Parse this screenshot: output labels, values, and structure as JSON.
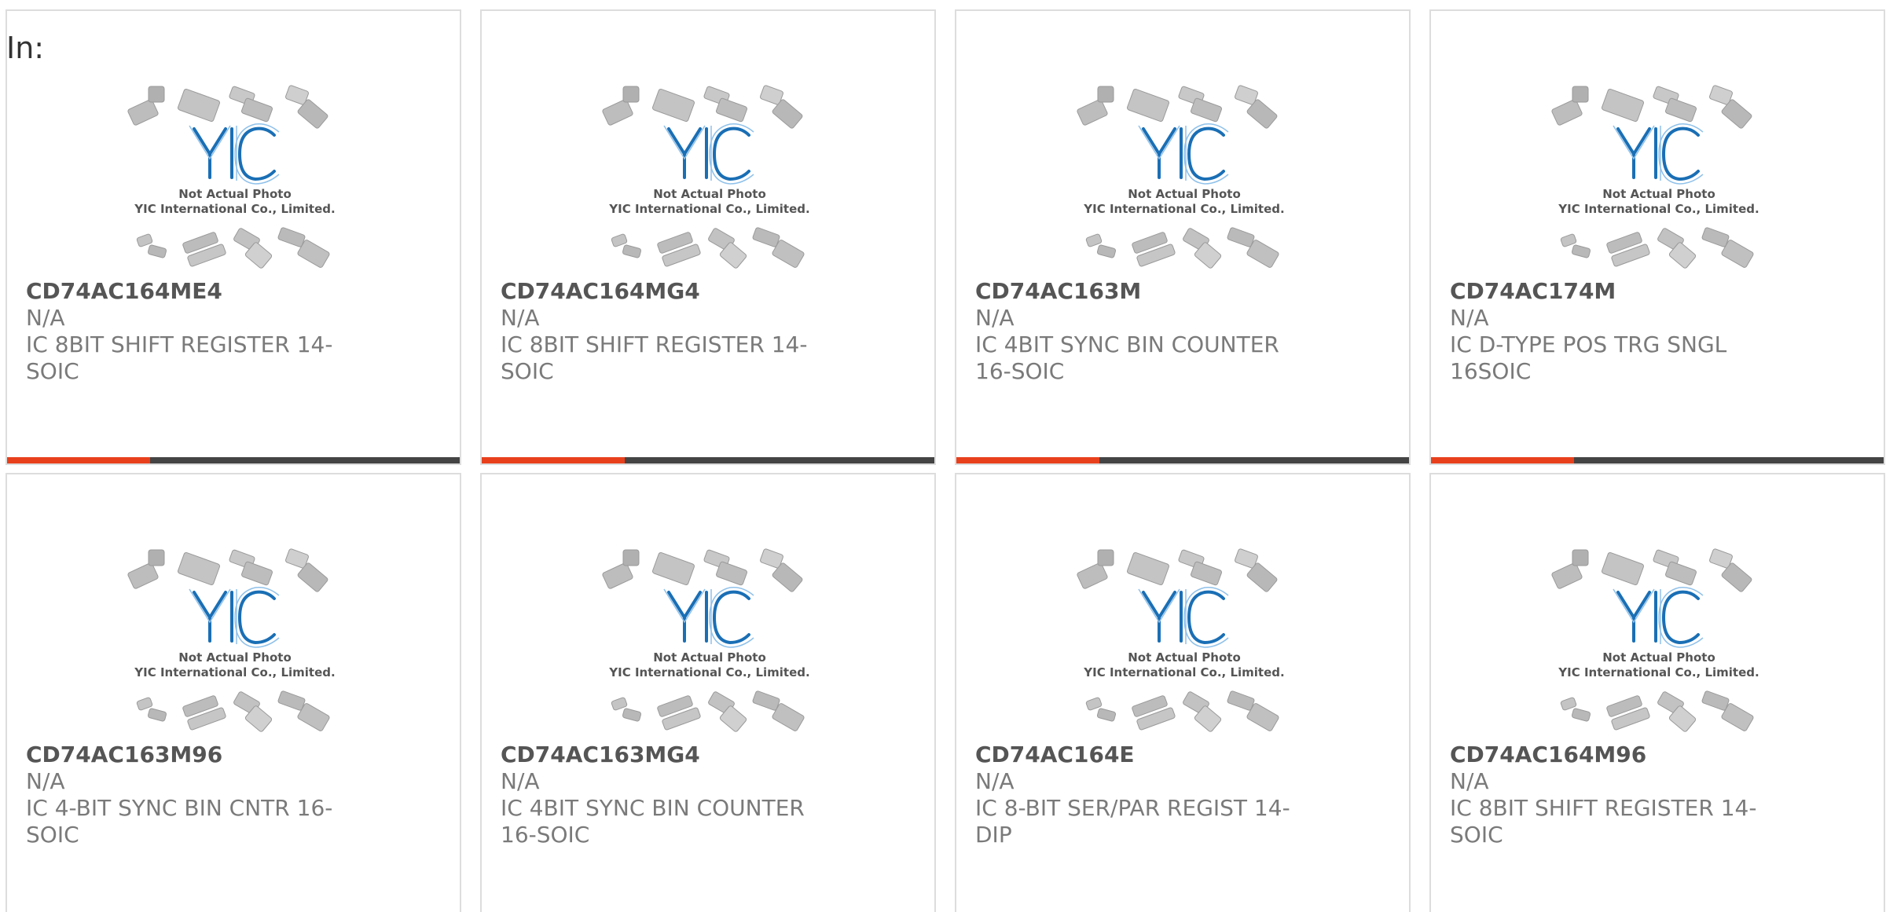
{
  "header": {
    "label": "In:"
  },
  "photo": {
    "notice_line1": "Not Actual Photo",
    "notice_line2": "YIC International Co., Limited.",
    "logo_text": "YIC"
  },
  "colors": {
    "accent": "#e8401c",
    "bar": "#444444",
    "logo": "#1a6fb5"
  },
  "products": [
    {
      "part": "CD74AC164ME4",
      "mfr": "N/A",
      "desc": "IC 8BIT SHIFT REGISTER 14-SOIC"
    },
    {
      "part": "CD74AC164MG4",
      "mfr": "N/A",
      "desc": "IC 8BIT SHIFT REGISTER 14-SOIC"
    },
    {
      "part": "CD74AC163M",
      "mfr": "N/A",
      "desc": "IC 4BIT SYNC BIN COUNTER 16-SOIC"
    },
    {
      "part": "CD74AC174M",
      "mfr": "N/A",
      "desc": "IC D-TYPE POS TRG SNGL 16SOIC"
    },
    {
      "part": "CD74AC163M96",
      "mfr": "N/A",
      "desc": "IC 4-BIT SYNC BIN CNTR 16-SOIC"
    },
    {
      "part": "CD74AC163MG4",
      "mfr": "N/A",
      "desc": "IC 4BIT SYNC BIN COUNTER 16-SOIC"
    },
    {
      "part": "CD74AC164E",
      "mfr": "N/A",
      "desc": "IC 8-BIT SER/PAR REGIST 14-DIP"
    },
    {
      "part": "CD74AC164M96",
      "mfr": "N/A",
      "desc": "IC 8BIT SHIFT REGISTER 14-SOIC"
    }
  ]
}
